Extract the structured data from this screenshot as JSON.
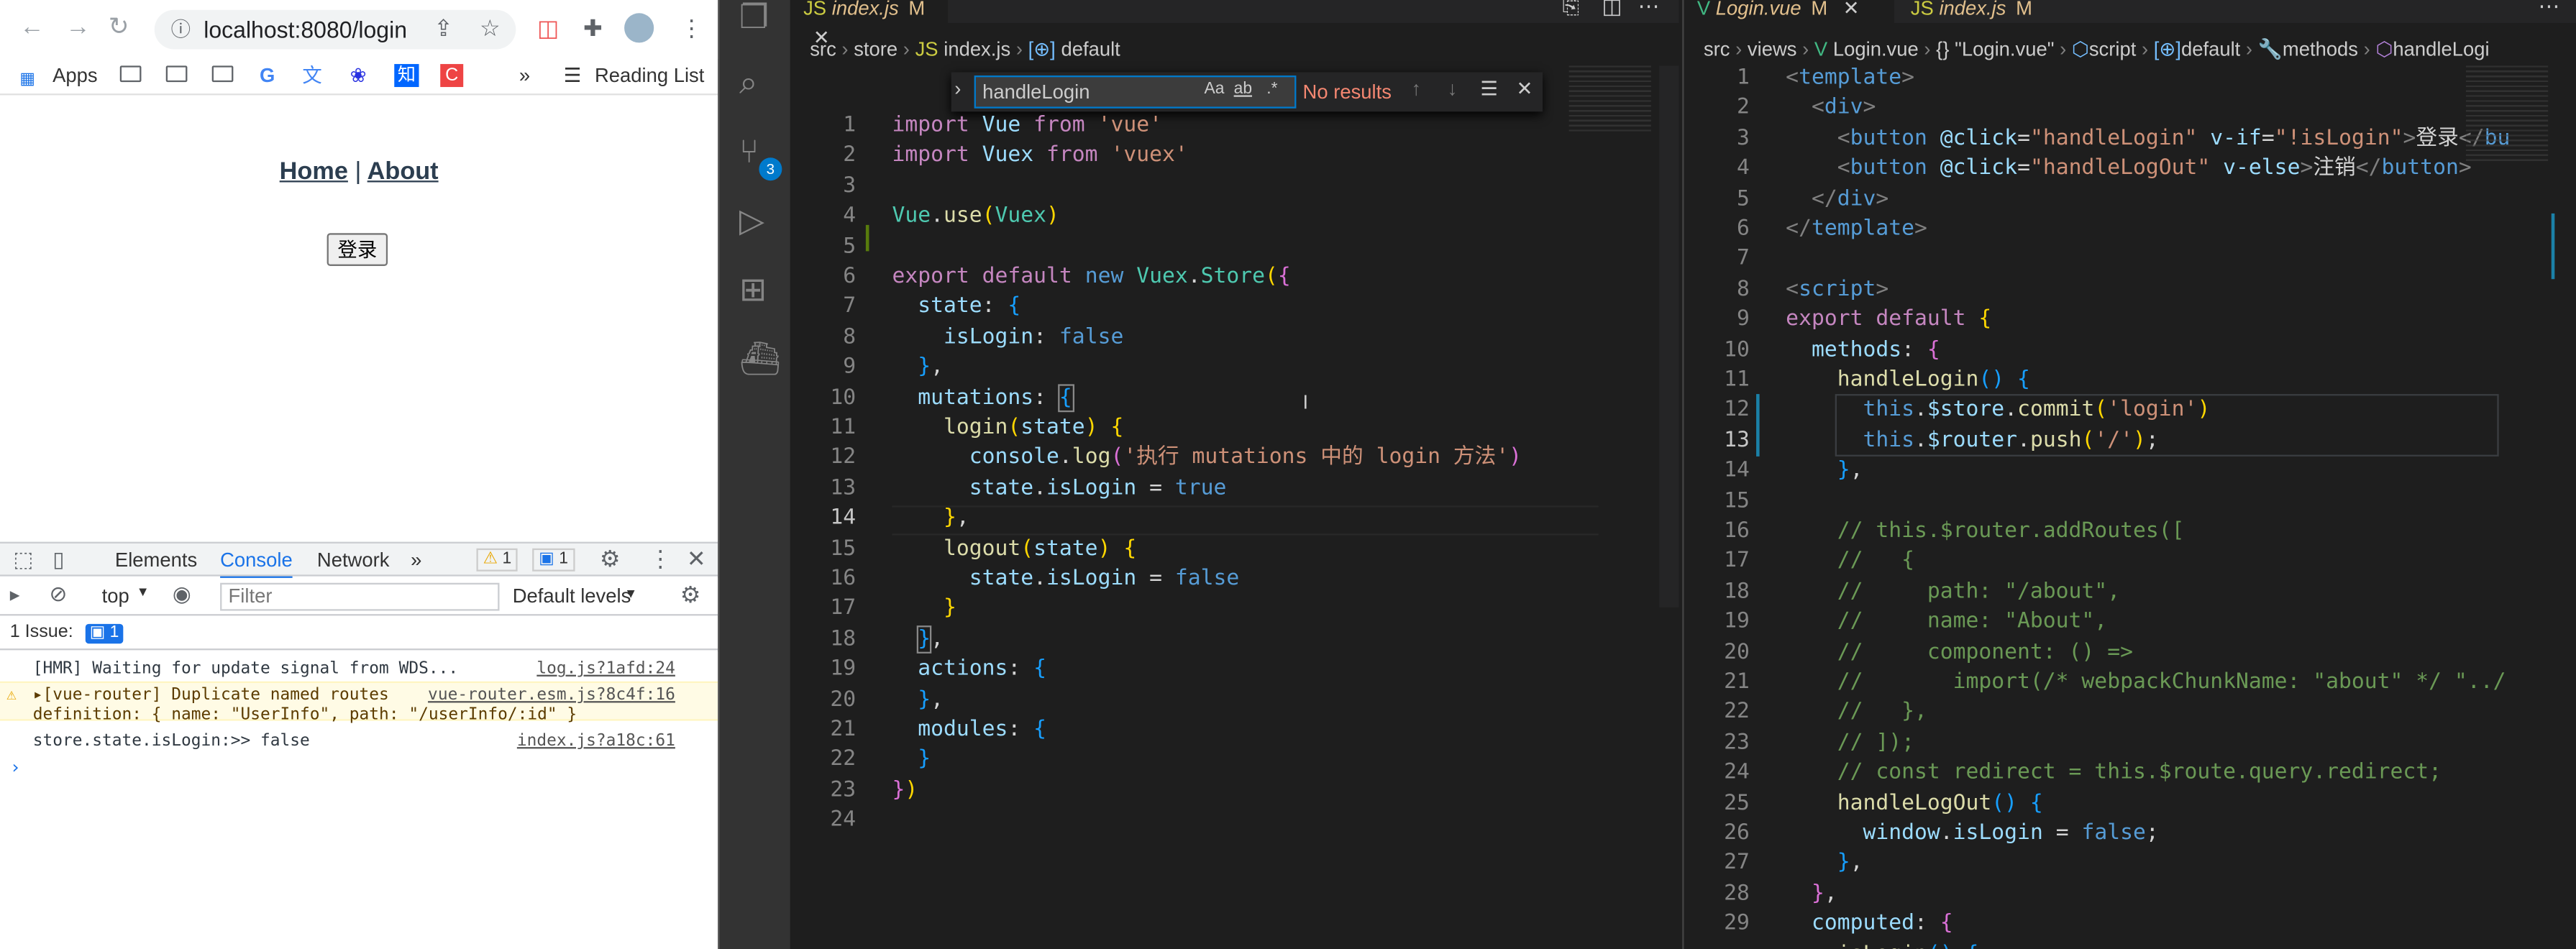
{
  "browser": {
    "url": "localhost:8080/login",
    "bookmarks": {
      "apps": "Apps",
      "reading_list": "Reading List"
    },
    "page": {
      "home_link": "Home",
      "separator": "|",
      "about_link": "About",
      "login_button": "登录"
    },
    "devtools": {
      "tabs": [
        "Elements",
        "Console",
        "Network"
      ],
      "more": "»",
      "warn_count": "1",
      "info_count": "1",
      "context": "top",
      "filter_placeholder": "Filter",
      "levels": "Default levels",
      "issues_label": "1 Issue:",
      "issues_count": "1",
      "console_lines": [
        {
          "text": "[HMR] Waiting for update signal from WDS...",
          "source": "log.js?1afd:24"
        },
        {
          "text": "▸[vue-router] Duplicate named routes",
          "text2": "definition: { name: \"UserInfo\", path: \"/userInfo/:id\" }",
          "source": "vue-router.esm.js?8c4f:16"
        },
        {
          "text": "store.state.isLogin:>> false",
          "source": "index.js?a18c:61"
        }
      ]
    }
  },
  "activity": {
    "scm_badge": "3"
  },
  "editor1": {
    "tab": {
      "name": "index.js",
      "status": "M"
    },
    "breadcrumbs": [
      "src",
      "store",
      "index.js",
      "default"
    ],
    "find": {
      "query": "handleLogin",
      "result": "No results",
      "opt_case": "Aa",
      "opt_word": "ab",
      "opt_regex": ".*"
    },
    "line_numbers": [
      "1",
      "2",
      "3",
      "4",
      "5",
      "6",
      "7",
      "8",
      "9",
      "10",
      "11",
      "12",
      "13",
      "14",
      "15",
      "16",
      "17",
      "18",
      "19",
      "20",
      "21",
      "22",
      "23",
      "24"
    ]
  },
  "editor2": {
    "tabs": [
      {
        "name": "Login.vue",
        "status": "M"
      },
      {
        "name": "index.js",
        "status": "M"
      }
    ],
    "breadcrumbs": [
      "src",
      "views",
      "Login.vue",
      "{} \"Login.vue\"",
      "script",
      "default",
      "methods",
      "handleLogi"
    ],
    "line_numbers": [
      "1",
      "2",
      "3",
      "4",
      "5",
      "6",
      "7",
      "8",
      "9",
      "10",
      "11",
      "12",
      "13",
      "14",
      "15",
      "16",
      "17",
      "18",
      "19",
      "20",
      "21",
      "22",
      "23",
      "24",
      "25",
      "26",
      "27",
      "28",
      "29"
    ]
  },
  "colors": {
    "link": "#1a73e8",
    "editor_bg": "#1e1e1e",
    "keyword": "#c586c0",
    "string": "#ce9178",
    "function": "#dcdcaa"
  }
}
